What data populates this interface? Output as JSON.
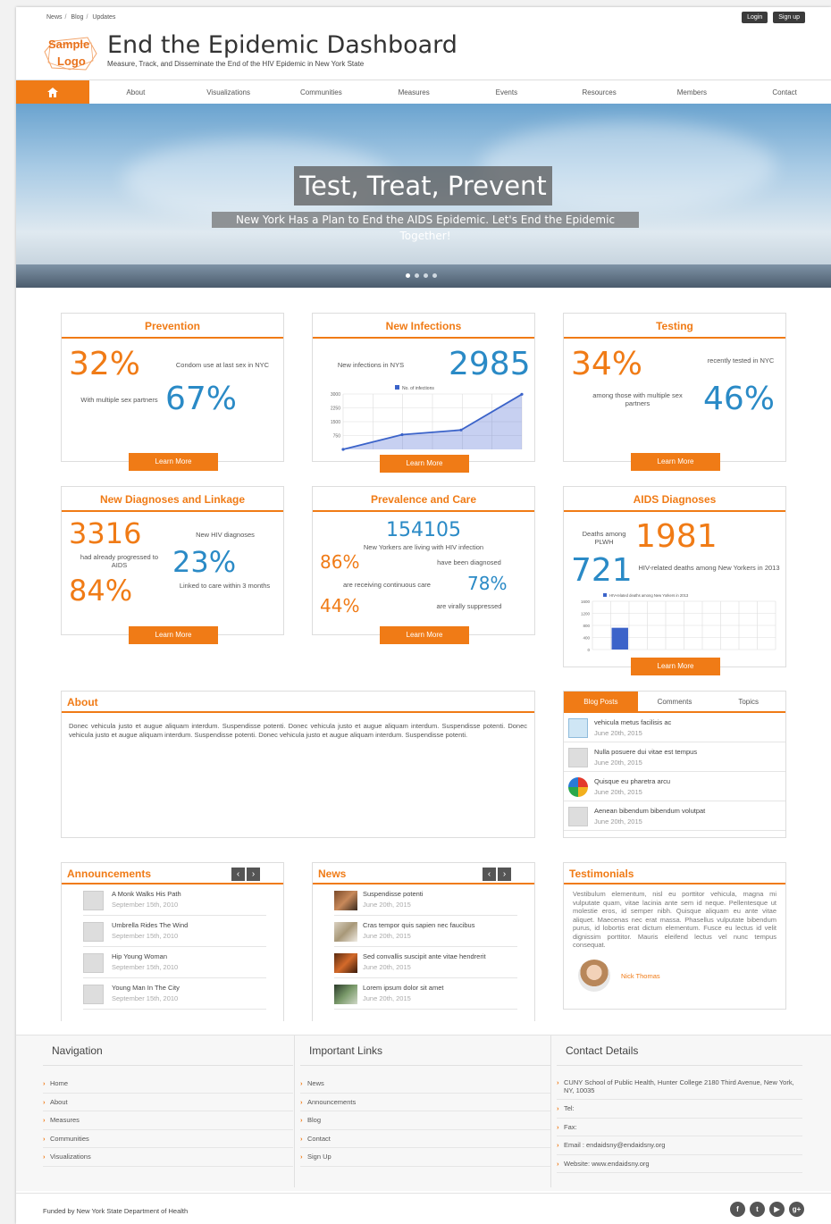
{
  "breadcrumbs": [
    "News",
    "Blog",
    "Updates"
  ],
  "auth": {
    "login": "Login",
    "signup": "Sign up"
  },
  "logo": {
    "line1": "Sample",
    "line2": "Logo"
  },
  "site": {
    "title": "End the Epidemic Dashboard",
    "subtitle": "Measure, Track, and Disseminate the End of the HIV Epidemic in New York State"
  },
  "nav": [
    "About",
    "Visualizations",
    "Communities",
    "Measures",
    "Events",
    "Resources",
    "Members",
    "Contact"
  ],
  "hero": {
    "headline": "Test, Treat, Prevent",
    "subline": "New York Has a Plan to End the AIDS Epidemic. Let's End the Epidemic Together!"
  },
  "learn_more": "Learn More",
  "prevention": {
    "title": "Prevention",
    "stat1": "32%",
    "stat1_label": "Condom use at last sex in NYC",
    "stat2": "67%",
    "stat2_label": "With multiple sex partners"
  },
  "new_infections": {
    "title": "New Infections",
    "label": "New infections in NYS",
    "value": "2985"
  },
  "testing": {
    "title": "Testing",
    "stat1": "34%",
    "stat1_label": "recently tested in NYC",
    "stat2": "46%",
    "stat2_label": "among those with multiple sex partners"
  },
  "diagnoses": {
    "title": "New Diagnoses and Linkage",
    "stat1": "3316",
    "stat1_label": "New HIV diagnoses",
    "stat2": "23%",
    "stat2_label": "had already progressed to AIDS",
    "stat3": "84%",
    "stat3_label": "Linked to care within 3 months"
  },
  "prevalence": {
    "title": "Prevalence and Care",
    "total": "154105",
    "total_label": "New Yorkers are living with HIV infection",
    "s1": "86%",
    "s1_label": "have been diagnosed",
    "s2": "78%",
    "s2_label": "are receiving continuous care",
    "s3": "44%",
    "s3_label": "are virally suppressed"
  },
  "aids": {
    "title": "AIDS Diagnoses",
    "stat1": "1981",
    "stat1_label": "Deaths among PLWH",
    "stat2": "721",
    "stat2_label": "HIV-related deaths among New Yorkers in 2013"
  },
  "chart_data": [
    {
      "type": "area",
      "legend": [
        "No. of infections"
      ],
      "yticks": [
        "3000",
        "2250",
        "1500",
        "750"
      ],
      "ylim": [
        0,
        3000
      ],
      "series": [
        {
          "name": "No. of infections",
          "values": [
            0,
            800,
            1050,
            2985
          ]
        }
      ]
    },
    {
      "type": "bar",
      "legend": [
        "HIV-related deaths among New Yorkers in 2013"
      ],
      "yticks": [
        "1600",
        "1200",
        "800",
        "400",
        "0"
      ],
      "ylim": [
        0,
        1600
      ],
      "series": [
        {
          "name": "HIV-related deaths among New Yorkers in 2013",
          "values": [
            0,
            721,
            0,
            0,
            0,
            0,
            0,
            0,
            0,
            0
          ]
        }
      ]
    }
  ],
  "about": {
    "title": "About",
    "text": "Donec vehicula justo et augue aliquam interdum. Suspendisse potenti. Donec vehicula justo et augue aliquam interdum. Suspendisse potenti. Donec vehicula justo et augue aliquam interdum. Suspendisse potenti. Donec vehicula justo et augue aliquam interdum. Suspendisse potenti."
  },
  "blog": {
    "tabs": [
      "Blog Posts",
      "Comments",
      "Topics"
    ],
    "posts": [
      {
        "title": "vehicula metus facilisis ac",
        "date": "June 20th, 2015"
      },
      {
        "title": "Nulla posuere dui vitae est tempus",
        "date": "June 20th, 2015"
      },
      {
        "title": "Quisque eu pharetra arcu",
        "date": "June 20th, 2015"
      },
      {
        "title": "Aenean bibendum bibendum volutpat",
        "date": "June 20th, 2015"
      }
    ]
  },
  "announcements": {
    "title": "Announcements",
    "items": [
      {
        "title": "A Monk Walks His Path",
        "date": "September 15th, 2010"
      },
      {
        "title": "Umbrella Rides The Wind",
        "date": "September 15th, 2010"
      },
      {
        "title": "Hip Young Woman",
        "date": "September 15th, 2010"
      },
      {
        "title": "Young Man In The City",
        "date": "September 15th, 2010"
      }
    ]
  },
  "news": {
    "title": "News",
    "items": [
      {
        "title": "Suspendisse potenti",
        "date": "June 20th, 2015"
      },
      {
        "title": "Cras tempor quis sapien nec faucibus",
        "date": "June 20th, 2015"
      },
      {
        "title": "Sed convallis suscipit ante vitae hendrerit",
        "date": "June 20th, 2015"
      },
      {
        "title": "Lorem ipsum dolor sit amet",
        "date": "June 20th, 2015"
      }
    ]
  },
  "testimonials": {
    "title": "Testimonials",
    "text": "Vestibulum elementum, nisl eu porttitor vehicula, magna mi vulputate quam, vitae lacinia ante sem id neque. Pellentesque ut molestie eros, id semper nibh. Quisque aliquam eu ante vitae aliquet. Maecenas nec erat massa. Phasellus vulputate bibendum purus, id lobortis erat dictum elementum. Fusce eu lectus id velit dignissim porttitor. Mauris eleifend lectus vel nunc tempus consequat.",
    "author": "Nick Thomas"
  },
  "footer": {
    "nav_title": "Navigation",
    "nav": [
      "Home",
      "About",
      "Measures",
      "Communities",
      "Visualizations"
    ],
    "links_title": "Important Links",
    "links": [
      "News",
      "Announcements",
      "Blog",
      "Contact",
      "Sign Up"
    ],
    "contact_title": "Contact Details",
    "contact": [
      "CUNY School of Public Health, Hunter College 2180 Third Avenue, New York, NY, 10035",
      "Tel:",
      "Fax:",
      "Email : endaidsny@endaidsny.org",
      "Website: www.endaidsny.org"
    ],
    "funded": "Funded by New York State Department of Health",
    "social_icons": [
      "facebook-icon",
      "twitter-icon",
      "youtube-icon",
      "google-plus-icon"
    ]
  },
  "colors": {
    "accent": "#f07b16",
    "blue": "#2a8ac6",
    "chart_blue": "#3b63c9"
  }
}
